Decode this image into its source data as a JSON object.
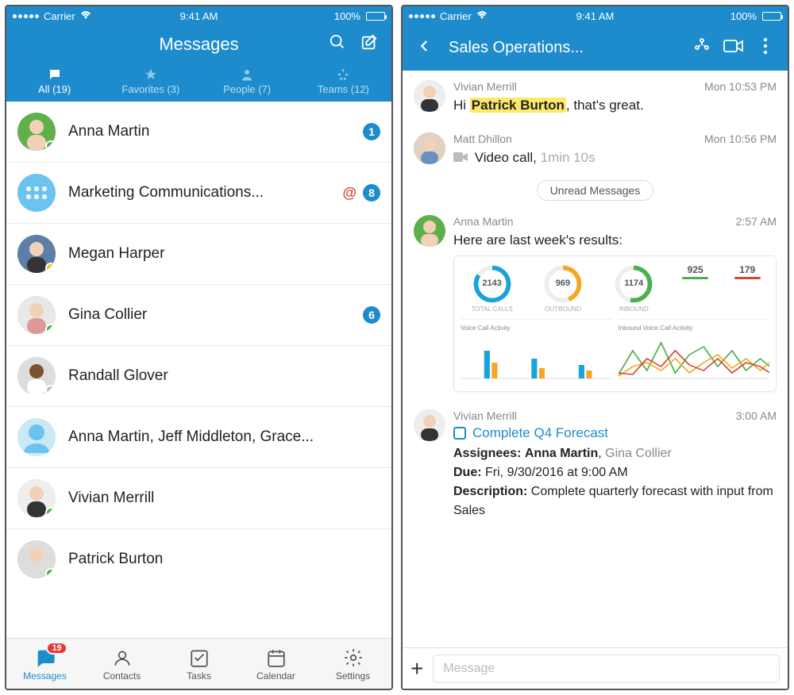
{
  "status": {
    "carrier": "Carrier",
    "time": "9:41 AM",
    "battery": "100%"
  },
  "left": {
    "title": "Messages",
    "subtabs": [
      "All (19)",
      "Favorites (3)",
      "People (7)",
      "Teams (12)"
    ],
    "conversations": [
      {
        "name": "Anna Martin",
        "badge": "1",
        "presence": "green",
        "avatar": "woman1"
      },
      {
        "name": "Marketing Communications...",
        "at": true,
        "badge": "8",
        "presence": null,
        "avatar": "team"
      },
      {
        "name": "Megan Harper",
        "presence": "yellow",
        "avatar": "woman2"
      },
      {
        "name": "Gina Collier",
        "badge": "6",
        "presence": "green",
        "avatar": "woman3"
      },
      {
        "name": "Randall Glover",
        "presence": "gray",
        "avatar": "man1"
      },
      {
        "name": "Anna Martin, Jeff Middleton, Grace...",
        "avatar": "group"
      },
      {
        "name": "Vivian Merrill",
        "presence": "green",
        "avatar": "woman4"
      },
      {
        "name": "Patrick Burton",
        "presence": "green",
        "avatar": "man2"
      }
    ],
    "tabbar": {
      "items": [
        "Messages",
        "Contacts",
        "Tasks",
        "Calendar",
        "Settings"
      ],
      "badge": "19"
    }
  },
  "right": {
    "title": "Sales Operations...",
    "messages": [
      {
        "sender": "Vivian Merrill",
        "time": "Mon 10:53 PM",
        "text_pre": "Hi ",
        "mention": "Patrick Burton",
        "text_post": ", that's great.",
        "avatar": "woman4"
      },
      {
        "sender": "Matt Dhillon",
        "time": "Mon 10:56 PM",
        "video_label": "Video call,",
        "video_dur": "1min 10s",
        "avatar": "man3"
      }
    ],
    "unread_label": "Unread Messages",
    "anna": {
      "sender": "Anna Martin",
      "time": "2:57 AM",
      "text": "Here are last week's results:"
    },
    "task_msg": {
      "sender": "Vivian Merrill",
      "time": "3:00 AM",
      "task_title": "Complete Q4 Forecast",
      "assignees_label": "Assignees:",
      "assignee1": "Anna Martin",
      "assignee2": "Gina Collier",
      "due_label": "Due:",
      "due_value": "Fri, 9/30/2016 at 9:00 AM",
      "desc_label": "Description:",
      "desc_value": "Complete quarterly forecast with input from Sales"
    },
    "input_placeholder": "Message"
  },
  "chart_data": {
    "type": "dashboard",
    "donuts": [
      {
        "label": "TOTAL CALLS",
        "value": 2143,
        "color": "#1aa3d9"
      },
      {
        "label": "OUTBOUND",
        "value": 969,
        "color": "#f5a623"
      },
      {
        "label": "INBOUND",
        "value": 1174,
        "color": "#4caf50"
      }
    ],
    "mini_stats": [
      {
        "label": "",
        "value": 925
      },
      {
        "label": "",
        "value": 179
      }
    ],
    "subcharts": [
      {
        "title": "Voice Call Activity",
        "type": "bar"
      },
      {
        "title": "Inbound Voice Call Activity",
        "type": "line"
      }
    ]
  }
}
